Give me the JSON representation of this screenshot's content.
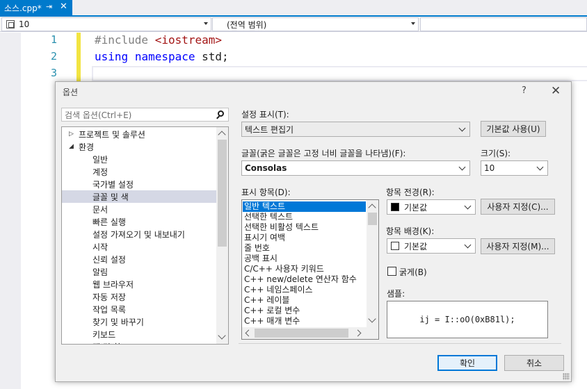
{
  "tab": {
    "title": "소스.cpp*",
    "pin_glyph": "⇥",
    "close_glyph": "✕"
  },
  "navigation": {
    "scope": "10",
    "member": "(전역 범위)"
  },
  "editor": {
    "line_numbers": [
      "1",
      "2",
      "3"
    ],
    "lines": [
      {
        "pre": "#include",
        "str": "<iostream>"
      },
      {
        "kw1": "using",
        "kw2": "namespace",
        "rest": "std;"
      }
    ]
  },
  "dialog": {
    "title": "옵션",
    "help_glyph": "?",
    "close_glyph": "✕",
    "search_placeholder": "검색 옵션(Ctrl+E)",
    "tree": [
      {
        "label": "프로젝트 및 솔루션",
        "level": 0,
        "expander": "▷"
      },
      {
        "label": "환경",
        "level": 0,
        "expander": "◢"
      },
      {
        "label": "일반",
        "level": 1
      },
      {
        "label": "계정",
        "level": 1
      },
      {
        "label": "국가별 설정",
        "level": 1
      },
      {
        "label": "글꼴 및 색",
        "level": 1,
        "selected": true
      },
      {
        "label": "문서",
        "level": 1
      },
      {
        "label": "빠른 실행",
        "level": 1
      },
      {
        "label": "설정 가져오기 및 내보내기",
        "level": 1
      },
      {
        "label": "시작",
        "level": 1
      },
      {
        "label": "신뢰 설정",
        "level": 1
      },
      {
        "label": "알림",
        "level": 1
      },
      {
        "label": "웹 브라우저",
        "level": 1
      },
      {
        "label": "자동 저장",
        "level": 1
      },
      {
        "label": "작업 목록",
        "level": 1
      },
      {
        "label": "찾기 및 바꾸기",
        "level": 1
      },
      {
        "label": "키보드",
        "level": 1
      },
      {
        "label": "탭 및 창",
        "level": 1
      }
    ],
    "show_settings_label": "설정 표시(T):",
    "show_settings_value": "텍스트 편집기",
    "use_defaults_button": "기본값 사용(U)",
    "font_label": "글꼴(굵은 글꼴은 고정 너비 글꼴을 나타냄)(F):",
    "font_value": "Consolas",
    "size_label": "크기(S):",
    "size_value": "10",
    "display_items_label": "표시 항목(D):",
    "display_items": [
      "일반 텍스트",
      "선택한 텍스트",
      "선택한 비활성 텍스트",
      "표시기 여백",
      "줄 번호",
      "공백 표시",
      "C/C++ 사용자 키워드",
      "C++ new/delete 연산자 함수",
      "C++ 네임스페이스",
      "C++ 레이블",
      "C++ 로컬 변수",
      "C++ 매개 변수"
    ],
    "item_foreground_label": "항목 전경(R):",
    "item_foreground_value": "기본값",
    "item_foreground_color": "#000000",
    "custom_foreground_button": "사용자 지정(C)...",
    "item_background_label": "항목 배경(K):",
    "item_background_value": "기본값",
    "item_background_color": "#ffffff",
    "custom_background_button": "사용자 지정(M)...",
    "bold_label": "굵게(B)",
    "sample_label": "샘플:",
    "sample_text": "ij = I::oO(0xB81l);",
    "ok_button": "확인",
    "cancel_button": "취소"
  }
}
